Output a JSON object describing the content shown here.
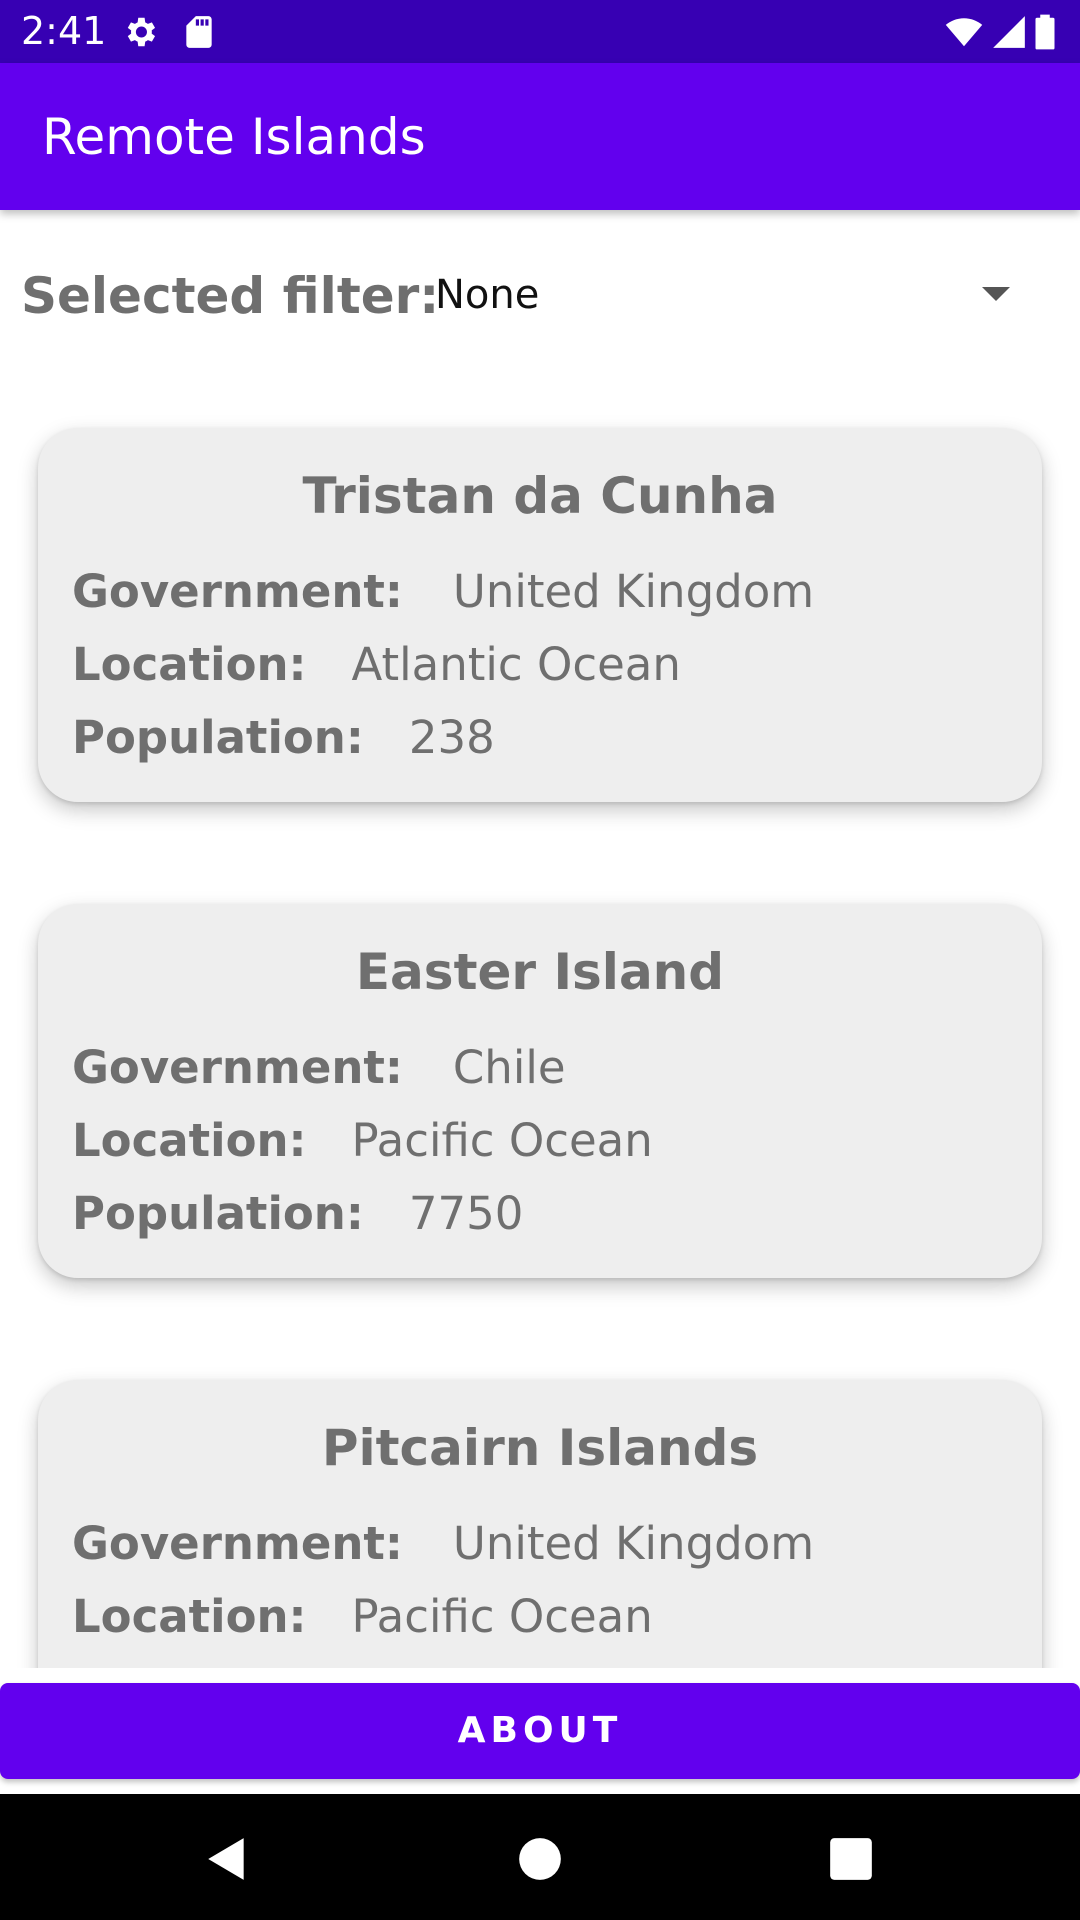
{
  "status_bar": {
    "time": "2:41",
    "icons": [
      "settings-icon",
      "sd-card-icon",
      "wifi-icon",
      "signal-icon",
      "battery-icon"
    ]
  },
  "app_bar": {
    "title": "Remote Islands"
  },
  "filter": {
    "label": "Selected filter:",
    "selected_value": "None"
  },
  "islands": [
    {
      "name": "Tristan da Cunha",
      "government_label": "Government:",
      "government": "United Kingdom",
      "location_label": "Location:",
      "location": "Atlantic Ocean",
      "population_label": "Population:",
      "population": "238"
    },
    {
      "name": "Easter Island",
      "government_label": "Government:",
      "government": "Chile",
      "location_label": "Location:",
      "location": "Pacific Ocean",
      "population_label": "Population:",
      "population": "7750"
    },
    {
      "name": "Pitcairn Islands",
      "government_label": "Government:",
      "government": "United Kingdom",
      "location_label": "Location:",
      "location": "Pacific Ocean"
    }
  ],
  "about_button": {
    "label": "ABOUT"
  },
  "colors": {
    "status_bar": "#3700b3",
    "primary": "#6200ee",
    "card_background": "#eeeeee",
    "text_gray": "#6f6f6f"
  }
}
